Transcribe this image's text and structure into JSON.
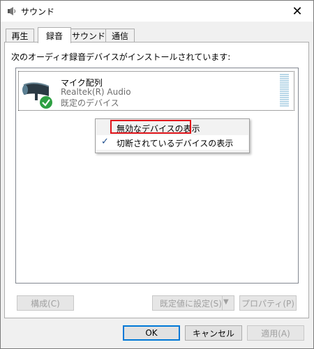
{
  "window": {
    "title": "サウンド",
    "close_glyph": "✕"
  },
  "tabs": [
    {
      "label": "再生",
      "active": false
    },
    {
      "label": "録音",
      "active": true
    },
    {
      "label": "サウンド",
      "active": false
    },
    {
      "label": "通信",
      "active": false
    }
  ],
  "panel": {
    "instruction": "次のオーディオ録音デバイスがインストールされています:"
  },
  "device": {
    "name": "マイク配列",
    "driver": "Realtek(R) Audio",
    "status": "既定のデバイス",
    "icon": "microphone-icon",
    "status_icon": "green-checkmark-icon"
  },
  "context_menu": {
    "items": [
      {
        "label": "無効なデバイスの表示",
        "checked": false,
        "highlighted": true
      },
      {
        "label": "切断されているデバイスの表示",
        "checked": true,
        "highlighted": false
      }
    ],
    "check_glyph": "✓",
    "highlight_color": "#e0141a"
  },
  "panel_buttons": {
    "configure": "構成(C)",
    "set_default": "既定値に設定(S)",
    "properties": "プロパティ(P)",
    "dropdown_glyph": "▼"
  },
  "dialog_buttons": {
    "ok": "OK",
    "cancel": "キャンセル",
    "apply": "適用(A)"
  },
  "colors": {
    "accent": "#0078d7",
    "check_green": "#2ea043"
  }
}
